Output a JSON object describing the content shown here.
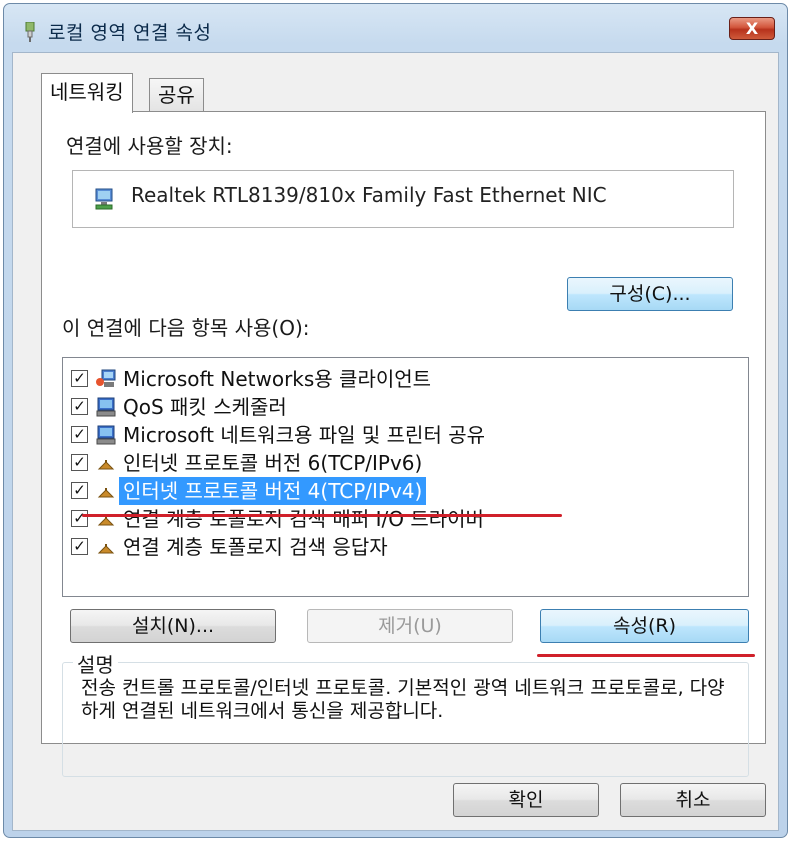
{
  "window": {
    "title": "로컬 영역 연결 속성",
    "close_label": "X"
  },
  "tabs": [
    {
      "label": "네트워킹"
    },
    {
      "label": "공유"
    }
  ],
  "device": {
    "connect_label": "연결에 사용할 장치:",
    "name": "Realtek RTL8139/810x Family Fast Ethernet NIC"
  },
  "buttons": {
    "configure": "구성(C)...",
    "install": "설치(N)...",
    "remove": "제거(U)",
    "properties": "속성(R)",
    "ok": "확인",
    "cancel": "취소"
  },
  "items_label": "이 연결에 다음 항목 사용(O):",
  "items": [
    {
      "label": "Microsoft Networks용 클라이언트",
      "checked": true,
      "icon": "network-client-icon"
    },
    {
      "label": "QoS 패킷 스케줄러",
      "checked": true,
      "icon": "computer-service-icon"
    },
    {
      "label": "Microsoft 네트워크용 파일 및 프린터 공유",
      "checked": true,
      "icon": "computer-service-icon"
    },
    {
      "label": "인터넷 프로토콜 버전 6(TCP/IPv6)",
      "checked": true,
      "icon": "protocol-icon"
    },
    {
      "label": "인터넷 프로토콜 버전 4(TCP/IPv4)",
      "checked": true,
      "icon": "protocol-icon",
      "selected": true
    },
    {
      "label": "연결 계층 토폴로지 검색 매퍼 I/O 드라이버",
      "checked": true,
      "icon": "protocol-icon"
    },
    {
      "label": "연결 계층 토폴로지 검색 응답자",
      "checked": true,
      "icon": "protocol-icon"
    }
  ],
  "description": {
    "title": "설명",
    "text": "전송 컨트롤 프로토콜/인터넷 프로토콜. 기본적인 광역 네트워크 프로토콜로, 다양하게 연결된 네트워크에서 통신을 제공합니다."
  },
  "colors": {
    "selection": "#3399ff",
    "annotation_red": "#d0202a"
  }
}
